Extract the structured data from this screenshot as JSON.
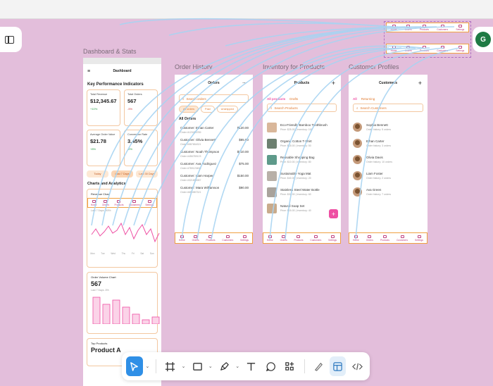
{
  "canvas": {
    "frame_labels": {
      "dashboard": "Dashboard & Stats",
      "orders": "Order History",
      "inventory": "Inventory for Products",
      "customers": "Customer Profiles"
    },
    "avatar_initial": "G"
  },
  "nav_labels": [
    "Home",
    "Orders",
    "Products",
    "Customers",
    "Settings"
  ],
  "dashboard": {
    "title": "Dashboard",
    "kpi_heading": "Key Performance Indicators",
    "kpis": [
      {
        "label": "Total Revenue",
        "value": "$12,345.67",
        "pct": "+10%"
      },
      {
        "label": "Total Orders",
        "value": "567",
        "pct": "-5%"
      },
      {
        "label": "Average Order Value",
        "value": "$21.78",
        "pct": "+8%"
      },
      {
        "label": "Conversion Rate",
        "value": "3.45%",
        "pct": "-2%"
      }
    ],
    "segments": [
      "Today",
      "Last 7 Days",
      "Last 30 Days"
    ],
    "charts_heading": "Charts and Analytics",
    "revenue_chart": {
      "title": "Revenue Chart",
      "sub": "Last 7 Days +45%",
      "days": [
        "Mon",
        "Tue",
        "Wed",
        "Thu",
        "Fri",
        "Sat",
        "Sun"
      ]
    },
    "volume_chart": {
      "title": "Order Volume Chart",
      "value": "567",
      "sub": "Last 7 Days -5%"
    },
    "top_products": {
      "title": "Top Products",
      "first": "Product A"
    }
  },
  "orders": {
    "title": "Orders",
    "search_placeholder": "Search orders",
    "chips": [
      "All orders",
      "Paid",
      "Unshipped"
    ],
    "section": "All Orders",
    "rows": [
      {
        "name": "Customer: Ethan Carter",
        "sub": "Order #123456789",
        "amount": "$120.00"
      },
      {
        "name": "Customer: Olivia Bennett",
        "sub": "Order #987654321",
        "amount": "$85.50"
      },
      {
        "name": "Customer: Noah Thompson",
        "sub": "Order #456789123",
        "amount": "$210.00"
      },
      {
        "name": "Customer: Ava Rodriguez",
        "sub": "Order #789123456",
        "amount": "$75.00"
      },
      {
        "name": "Customer: Liam Harper",
        "sub": "Order #321654987",
        "amount": "$150.00"
      },
      {
        "name": "Customer: Mara Williamson",
        "sub": "Order #654987321",
        "amount": "$90.00"
      }
    ]
  },
  "products": {
    "title": "Products",
    "tabs": [
      "All products",
      "Drafts"
    ],
    "search_placeholder": "Search Products",
    "rows": [
      {
        "name": "Eco-Friendly Bamboo Toothbrush",
        "sub": "Price: $25.00 | Inventory: 100",
        "color": "#d9b79a"
      },
      {
        "name": "Organic Cotton T-Shirt",
        "sub": "Price: $18.00 | Inventory: 50",
        "color": "#6d8070"
      },
      {
        "name": "Reusable Shopping Bag",
        "sub": "Price: $10.00 | Inventory: 80",
        "color": "#5e9a8a"
      },
      {
        "name": "Sustainable Yoga Mat",
        "sub": "Price: $40.00 | Inventory: 20",
        "color": "#b8b0a8"
      },
      {
        "name": "Stainless Steel Water Bottle",
        "sub": "Price: $32.00 | Inventory: 60",
        "color": "#a9a39c"
      },
      {
        "name": "Natural Soap Set",
        "sub": "Price: $15.00 | Inventory: 40",
        "color": "#c9ab8c"
      }
    ]
  },
  "customers": {
    "title": "Customers",
    "tabs": [
      "All",
      "Returning"
    ],
    "search_placeholder": "Search Customers",
    "rows": [
      {
        "name": "Sophia Bennett",
        "sub": "Order history: 5 orders"
      },
      {
        "name": "Ethan Carter",
        "sub": "Order history: 3 orders"
      },
      {
        "name": "Olivia Davis",
        "sub": "Order history: 10 orders"
      },
      {
        "name": "Liam Foster",
        "sub": "Order history: 2 orders"
      },
      {
        "name": "Ava Green",
        "sub": "Order history: 7 orders"
      }
    ]
  },
  "colors": {
    "accent": "#ee4fa3",
    "wire": "#a8d4f2",
    "canvas": "#e3bedb"
  }
}
